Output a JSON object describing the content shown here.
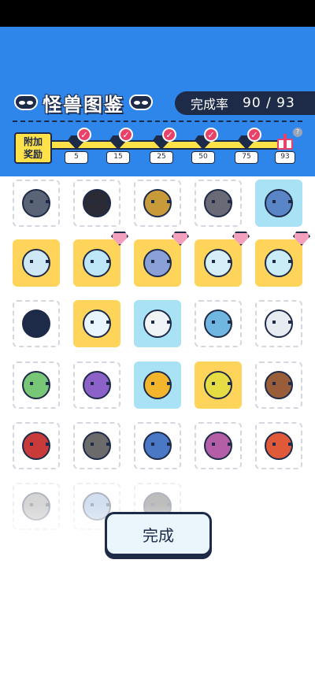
{
  "header": {
    "title": "怪兽图鉴",
    "rate_label": "完成率",
    "rate_value": "90 / 93",
    "reward_label_line1": "附加",
    "reward_label_line2": "奖励",
    "milestones": [
      "5",
      "15",
      "25",
      "50",
      "75"
    ],
    "final_milestone": "93"
  },
  "colors": {
    "header_bg": "#2f86ea",
    "navy": "#1d2a48",
    "yellow": "#ffd45a",
    "blue_card": "#a9e2f5",
    "pink_check": "#e8426a"
  },
  "grid": {
    "cards": [
      {
        "style": "plain",
        "icon": "agent-seated-icon",
        "color": "#5b6477"
      },
      {
        "style": "plain",
        "icon": "agent-black-suit-icon",
        "color": "#2b2b35"
      },
      {
        "style": "plain",
        "icon": "agent-blonde-icon",
        "color": "#c99a3a"
      },
      {
        "style": "plain",
        "icon": "agent-bald-icon",
        "color": "#6a6a76"
      },
      {
        "style": "blue",
        "icon": "blue-crystal-icon",
        "color": "#5a86c8"
      },
      {
        "style": "yellow",
        "icon": "snowman-icon",
        "color": "#cfe8f5",
        "badge": false
      },
      {
        "style": "yellow",
        "icon": "ice-blob-icon",
        "color": "#bde6f7",
        "badge": true
      },
      {
        "style": "yellow",
        "icon": "wolf-icon",
        "color": "#8aa0d6",
        "badge": true
      },
      {
        "style": "yellow",
        "icon": "ice-rock-icon",
        "color": "#d6eef8",
        "badge": true
      },
      {
        "style": "yellow",
        "icon": "slime-icon",
        "color": "#c9ecf7",
        "badge": true
      },
      {
        "style": "plain",
        "icon": "shadow-beast-icon",
        "color": "#1d2a48"
      },
      {
        "style": "yellow",
        "icon": "ice-cream-icon",
        "color": "#e9f6ff"
      },
      {
        "style": "blue",
        "icon": "fluffy-sprout-icon",
        "color": "#f0f4f6"
      },
      {
        "style": "plain",
        "icon": "ice-gem-icon",
        "color": "#6fb7e0"
      },
      {
        "style": "plain",
        "icon": "yeti-icon",
        "color": "#e7ecf2"
      },
      {
        "style": "plain",
        "icon": "frog-icon",
        "color": "#77c777"
      },
      {
        "style": "plain",
        "icon": "purple-dino-icon",
        "color": "#8c62c9"
      },
      {
        "style": "blue",
        "icon": "sunflower-icon",
        "color": "#f3b52c"
      },
      {
        "style": "yellow",
        "icon": "flower-sprout-icon",
        "color": "#e6dd45"
      },
      {
        "style": "plain",
        "icon": "bear-icon",
        "color": "#9a5d3a"
      },
      {
        "style": "plain",
        "icon": "mushroom-icon",
        "color": "#c93a3a"
      },
      {
        "style": "plain",
        "icon": "hyena-icon",
        "color": "#6b6b6b"
      },
      {
        "style": "plain",
        "icon": "blue-bug-icon",
        "color": "#4a78c4"
      },
      {
        "style": "plain",
        "icon": "shopper-lady-icon",
        "color": "#b55ea8"
      },
      {
        "style": "plain",
        "icon": "red-flower-icon",
        "color": "#e05a3a"
      },
      {
        "style": "plain",
        "faded": true,
        "icon": "ghost-icon",
        "color": "#8a8a8a"
      },
      {
        "style": "plain",
        "faded": true,
        "icon": "spiky-dino-icon",
        "color": "#7da4d6"
      },
      {
        "style": "plain",
        "faded": true,
        "icon": "mammoth-icon",
        "color": "#444444"
      }
    ]
  },
  "footer": {
    "done_label": "完成"
  }
}
